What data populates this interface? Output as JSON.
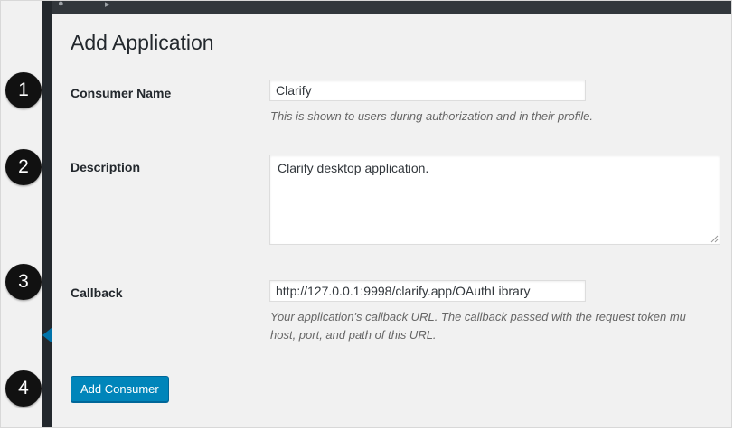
{
  "page": {
    "title": "Add Application"
  },
  "form": {
    "consumer_name": {
      "label": "Consumer Name",
      "value": "Clarify",
      "help": "This is shown to users during authorization and in their profile."
    },
    "description": {
      "label": "Description",
      "value": "Clarify desktop application."
    },
    "callback": {
      "label": "Callback",
      "value": "http://127.0.0.1:9998/clarify.app/OAuthLibrary",
      "help_line1": "Your application's callback URL. The callback passed with the request token mu",
      "help_line2": "host, port, and path of this URL."
    },
    "submit_label": "Add Consumer"
  },
  "steps": [
    "1",
    "2",
    "3",
    "4"
  ],
  "colors": {
    "primary_button": "#0085ba",
    "sidebar": "#23282d",
    "page_background": "#f1f1f1",
    "step_badge": "#111111"
  }
}
